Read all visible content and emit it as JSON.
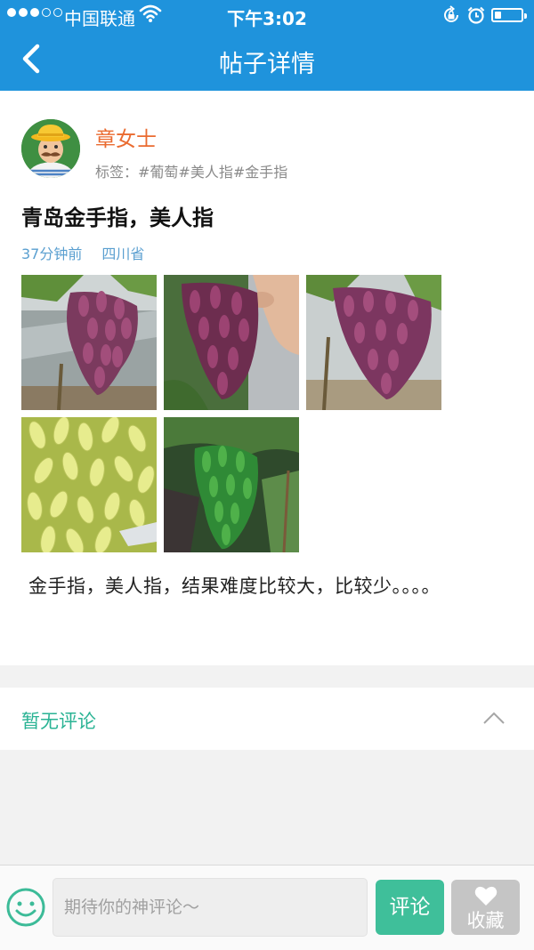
{
  "status_bar": {
    "carrier": "中国联通",
    "time": "下午3:02",
    "battery_level": 0.25
  },
  "nav": {
    "title": "帖子详情",
    "back_icon": "chevron-left-icon"
  },
  "post": {
    "author": "章女士",
    "tags": "标签：#葡萄#美人指#金手指",
    "title": "青岛金手指，美人指",
    "time_ago": "37分钟前",
    "location": "四川省",
    "image_count": 5,
    "body": "金手指，美人指，结果难度比较大，比较少。。。。"
  },
  "comments": {
    "empty_text": "暂无评论",
    "toggle_icon": "chevron-up-icon"
  },
  "bottom_bar": {
    "emoji_icon": "smiley-icon",
    "input_placeholder": "期待你的神评论～",
    "comment_button": "评论",
    "favorite_button": "收藏",
    "favorite_icon": "heart-icon"
  },
  "colors": {
    "nav_blue": "#1f93dc",
    "author_orange": "#ea6b30",
    "meta_blue": "#5a9fd0",
    "accent_green": "#2ab394",
    "comment_button_green": "#3fbf9a",
    "favorite_button_gray": "#c5c5c5"
  }
}
